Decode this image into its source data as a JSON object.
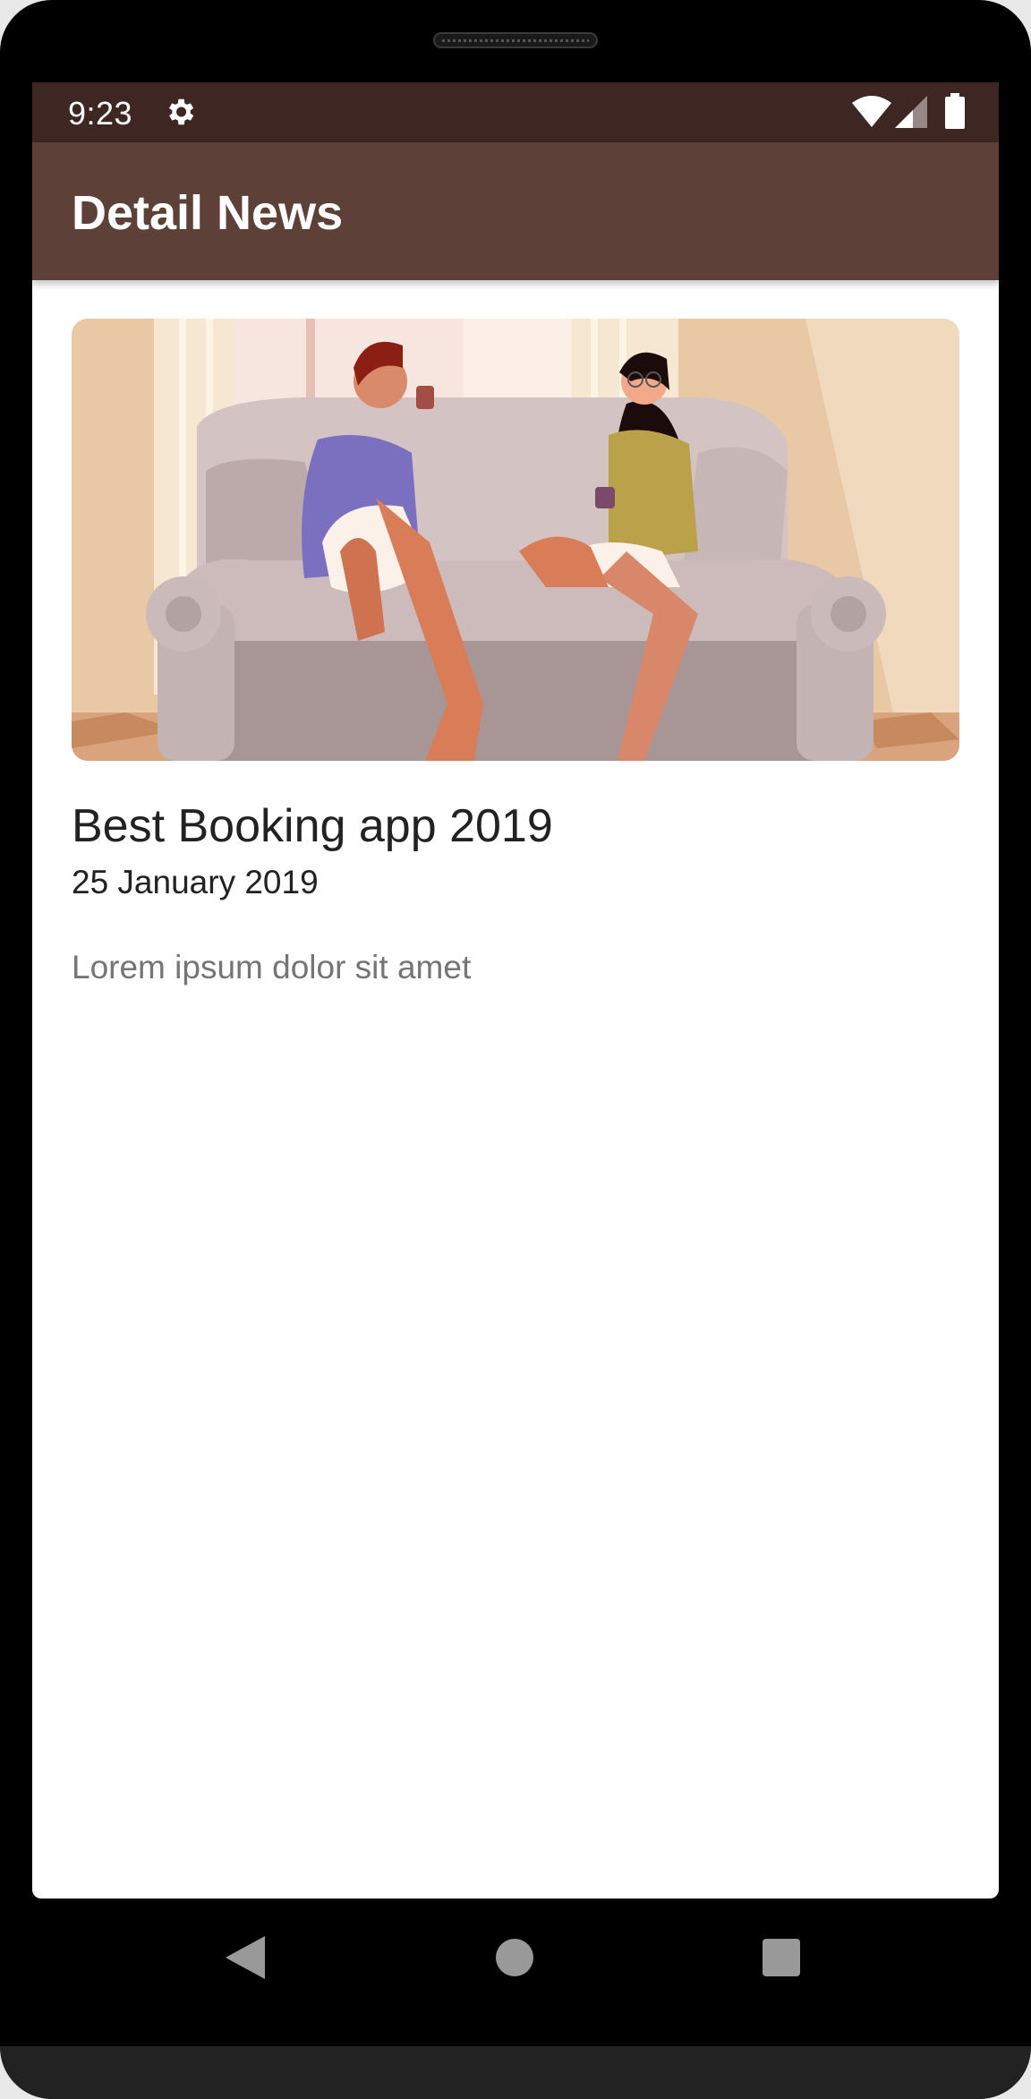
{
  "status_bar": {
    "time": "9:23",
    "icons": [
      "gear-icon",
      "wifi-icon",
      "signal-icon",
      "battery-icon"
    ],
    "background": "#3e2723"
  },
  "app_bar": {
    "title": "Detail News",
    "background": "#5d4037"
  },
  "news": {
    "image": "couple-on-sofa-illustration",
    "title": "Best Booking app 2019",
    "date": "25 January 2019",
    "body": "Lorem ipsum dolor sit amet"
  },
  "navigation": {
    "icons": [
      "back-icon",
      "home-icon",
      "recents-icon"
    ]
  }
}
